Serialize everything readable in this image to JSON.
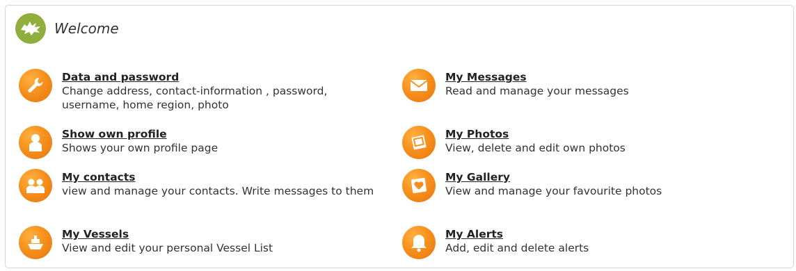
{
  "header": {
    "title": "Welcome",
    "logo_icon": "dragon-icon"
  },
  "colors": {
    "accent": "#f6901d",
    "logo_bg": "#8fae3e"
  },
  "items": [
    {
      "title": "Data and password",
      "desc": "Change address, contact-information , password, username, home region, photo",
      "icon": "wrench-icon"
    },
    {
      "title": "My Messages",
      "desc": "Read and manage your messages",
      "icon": "envelope-icon"
    },
    {
      "title": "Show own profile",
      "desc": "Shows your own profile page",
      "icon": "person-icon"
    },
    {
      "title": "My Photos",
      "desc": "View, delete and edit own photos",
      "icon": "photos-icon"
    },
    {
      "title": "My contacts",
      "desc": "view and manage your contacts. Write messages to them",
      "icon": "contacts-icon"
    },
    {
      "title": "My Gallery",
      "desc": "View and manage your favourite photos",
      "icon": "gallery-heart-icon"
    },
    {
      "title": "My Vessels",
      "desc": "View and edit your personal Vessel List",
      "icon": "ship-icon"
    },
    {
      "title": "My Alerts",
      "desc": "Add, edit and delete alerts",
      "icon": "bell-icon"
    }
  ]
}
